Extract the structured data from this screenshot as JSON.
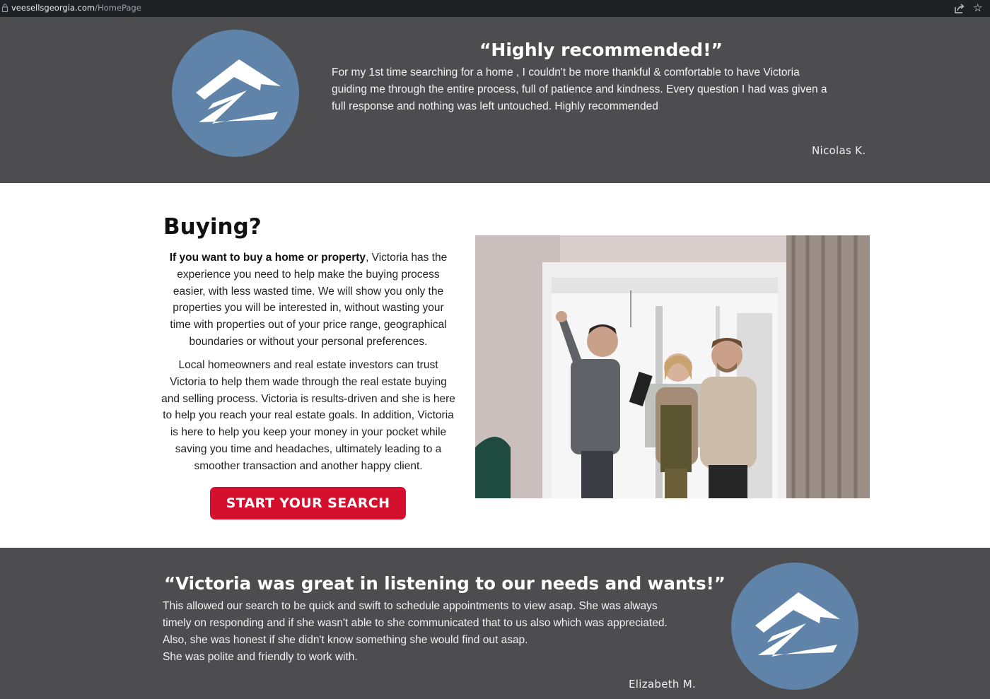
{
  "browser": {
    "domain": "veesellsgeorgia.com",
    "path": "/HomePage"
  },
  "testimonial_top": {
    "title": "“Highly recommended!”",
    "body": "For my 1st time searching for a home , I couldn't be more thankful & comfortable to have Victoria guiding me through the entire process, full of patience and kindness. Every question I had was given a full response and nothing was left untouched. Highly recommended",
    "author": "Nicolas K."
  },
  "buying": {
    "title": "Buying?",
    "para1_bold": "If you want to buy a home or property",
    "para1_rest": ", Victoria has the experience you need to help make the buying process easier, with less wasted time. We will show you only the properties you will be interested in, without wasting your time with properties out of your price range, geographical boundaries or without your personal preferences.",
    "para2": "Local homeowners and real estate investors can trust Victoria to help them wade through the real estate buying and selling process. Victoria is results-driven and she is here to help you reach your real estate goals. In addition, Victoria is here to help you keep your money in your pocket while saving you time and headaches, ultimately leading to a smoother transaction and another happy client.",
    "cta_label": "START YOUR SEARCH"
  },
  "testimonial_bottom": {
    "title": "“Victoria was great in listening to our needs and wants!”",
    "lines": [
      "This allowed our search to be quick and swift to schedule appointments to view asap. She was always",
      "timely on responding and if she wasn't able to she communicated that to us also which was appreciated.",
      "Also, she was honest if she didn't know something she would find out asap.",
      "She was polite and friendly to work with."
    ],
    "author": "Elizabeth M."
  },
  "colors": {
    "band": "#4d4d4f",
    "zillow_blue": "#5f83a9",
    "cta_red": "#d5102e"
  },
  "icons": [
    "lock-icon",
    "share-icon",
    "star-icon",
    "zillow-logo-icon"
  ]
}
